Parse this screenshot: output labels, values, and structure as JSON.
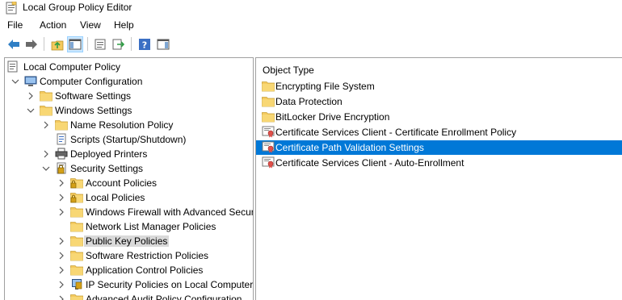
{
  "window": {
    "title": "Local Group Policy Editor"
  },
  "menu": [
    "File",
    "Action",
    "View",
    "Help"
  ],
  "toolbar": [
    "back-icon",
    "forward-icon",
    "up-folder-icon",
    "show-hide-tree-icon",
    "properties-icon",
    "export-list-icon",
    "help-icon",
    "show-hide-action-pane-icon"
  ],
  "tree": [
    {
      "label": "Local Computer Policy",
      "level": 0,
      "expander": "none",
      "icon": "policy-icon"
    },
    {
      "label": "Computer Configuration",
      "level": 0,
      "expander": "expanded",
      "icon": "computer-icon"
    },
    {
      "label": "Software Settings",
      "level": 1,
      "expander": "collapsed",
      "icon": "folder-icon"
    },
    {
      "label": "Windows Settings",
      "level": 1,
      "expander": "expanded",
      "icon": "folder-icon"
    },
    {
      "label": "Name Resolution Policy",
      "level": 2,
      "expander": "collapsed",
      "icon": "folder-icon"
    },
    {
      "label": "Scripts (Startup/Shutdown)",
      "level": 2,
      "expander": "none",
      "icon": "script-icon"
    },
    {
      "label": "Deployed Printers",
      "level": 2,
      "expander": "collapsed",
      "icon": "printer-icon"
    },
    {
      "label": "Security Settings",
      "level": 2,
      "expander": "expanded",
      "icon": "security-icon"
    },
    {
      "label": "Account Policies",
      "level": 3,
      "expander": "collapsed",
      "icon": "locked-folder-icon"
    },
    {
      "label": "Local Policies",
      "level": 3,
      "expander": "collapsed",
      "icon": "locked-folder-icon"
    },
    {
      "label": "Windows Firewall with Advanced Secur",
      "level": 3,
      "expander": "collapsed",
      "icon": "folder-icon"
    },
    {
      "label": "Network List Manager Policies",
      "level": 3,
      "expander": "none",
      "icon": "folder-icon"
    },
    {
      "label": "Public Key Policies",
      "level": 3,
      "expander": "collapsed",
      "icon": "folder-icon",
      "selected": true
    },
    {
      "label": "Software Restriction Policies",
      "level": 3,
      "expander": "collapsed",
      "icon": "folder-icon"
    },
    {
      "label": "Application Control Policies",
      "level": 3,
      "expander": "collapsed",
      "icon": "folder-icon"
    },
    {
      "label": "IP Security Policies on Local Computer",
      "level": 3,
      "expander": "collapsed",
      "icon": "ipsec-icon"
    },
    {
      "label": "Advanced Audit Policy Configuration",
      "level": 3,
      "expander": "collapsed",
      "icon": "folder-icon"
    }
  ],
  "list": {
    "column_header": "Object Type",
    "items": [
      {
        "label": "Encrypting File System",
        "icon": "folder-icon"
      },
      {
        "label": "Data Protection",
        "icon": "folder-icon"
      },
      {
        "label": "BitLocker Drive Encryption",
        "icon": "folder-icon"
      },
      {
        "label": "Certificate Services Client - Certificate Enrollment Policy",
        "icon": "certificate-icon"
      },
      {
        "label": "Certificate Path Validation Settings",
        "icon": "certificate-icon",
        "selected": true
      },
      {
        "label": "Certificate Services Client - Auto-Enrollment",
        "icon": "certificate-icon"
      }
    ]
  },
  "colors": {
    "selection": "#0078d7",
    "folder": "#f4c95d",
    "tree_selection": "#d9d9d9"
  }
}
